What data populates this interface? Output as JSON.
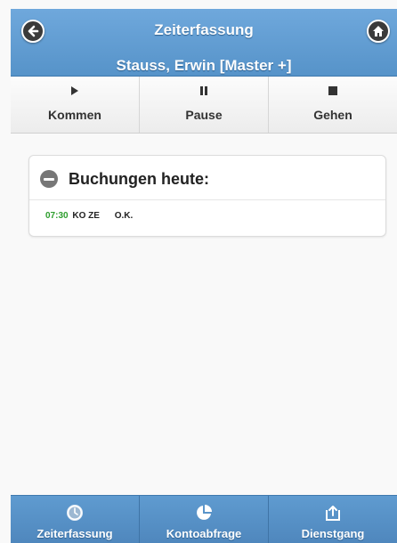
{
  "header": {
    "title": "Zeiterfassung",
    "subtitle": "Stauss, Erwin [Master +]",
    "back_icon": "arrow-left-icon",
    "home_icon": "home-icon"
  },
  "toolbar": {
    "items": [
      {
        "label": "Kommen",
        "icon": "play-icon"
      },
      {
        "label": "Pause",
        "icon": "pause-icon"
      },
      {
        "label": "Gehen",
        "icon": "stop-icon"
      }
    ]
  },
  "bookings": {
    "title": "Buchungen heute:",
    "entries": [
      {
        "time": "07:30",
        "code": "KO ZE",
        "status": "O.K."
      }
    ]
  },
  "footer": {
    "items": [
      {
        "label": "Zeiterfassung",
        "icon": "clock-icon"
      },
      {
        "label": "Kontoabfrage",
        "icon": "pie-chart-icon"
      },
      {
        "label": "Dienstgang",
        "icon": "upload-icon"
      }
    ]
  },
  "colors": {
    "header_blue": "#5f9bd0",
    "time_green": "#2e9e2e"
  }
}
